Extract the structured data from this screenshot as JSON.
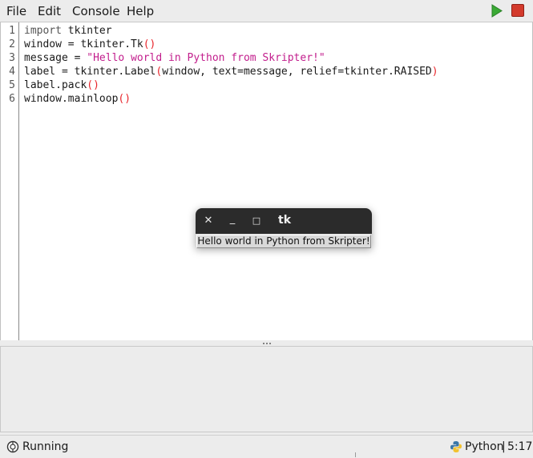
{
  "menubar": {
    "items": [
      "File",
      "Edit",
      "Console",
      "Help"
    ],
    "run_icon": "play-icon",
    "stop_icon": "stop-icon",
    "run_color": "#3aaa35",
    "stop_color": "#d33a2c"
  },
  "editor": {
    "line_numbers": [
      "1",
      "2",
      "3",
      "4",
      "5",
      "6"
    ],
    "lines": [
      {
        "kw": "import",
        "rest": " tkinter"
      },
      {
        "a": "window = tkinter.Tk",
        "p1": "(",
        "p2": ")"
      },
      {
        "a": "message = ",
        "str": "\"Hello world in Python from Skripter!\""
      },
      {
        "a": "label = tkinter.Label",
        "p1": "(",
        "mid": "window, text=message, relief=tkinter.RAISED",
        "p2": ")"
      },
      {
        "a": "label.pack",
        "p1": "(",
        "p2": ")"
      },
      {
        "a": "window.mainloop",
        "p1": "(",
        "p2": ")"
      }
    ]
  },
  "tk_window": {
    "close": "✕",
    "minimize": "_",
    "maximize": "□",
    "title": "tk",
    "label": "Hello world in Python from Skripter!"
  },
  "statusbar": {
    "status_icon": "running-icon",
    "status": "Running",
    "language_icon": "python-icon",
    "language": "Python",
    "separator": "|",
    "cursor": "5:17"
  }
}
